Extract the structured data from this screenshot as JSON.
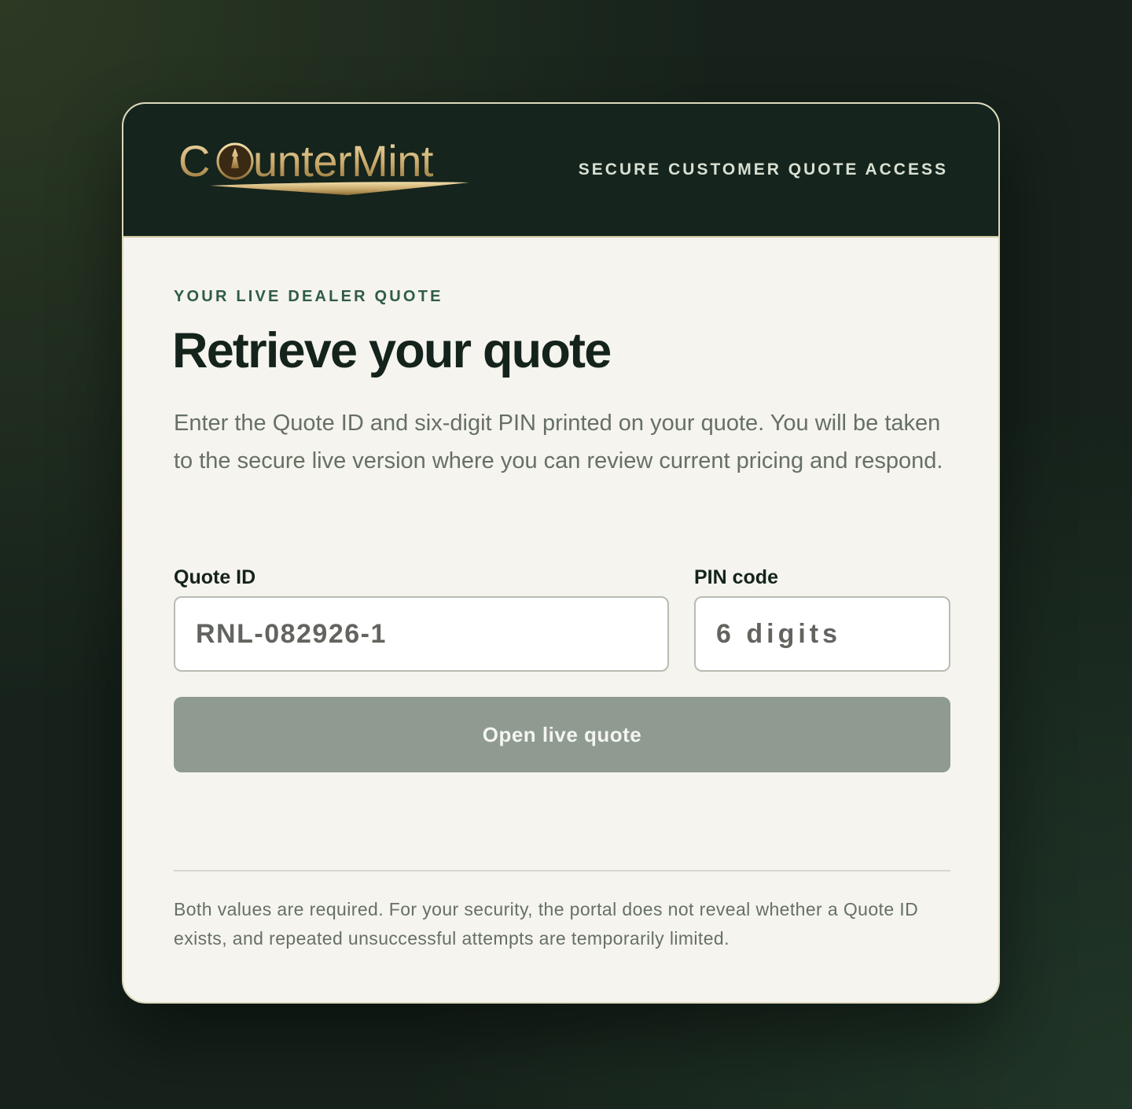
{
  "header": {
    "brand": "CounterMint",
    "tagline": "SECURE CUSTOMER QUOTE ACCESS"
  },
  "main": {
    "eyebrow": "YOUR LIVE DEALER QUOTE",
    "title": "Retrieve your quote",
    "description": "Enter the Quote ID and six-digit PIN printed on your quote. You will be taken to the secure live version where you can review current pricing and respond."
  },
  "form": {
    "quote_id_label": "Quote ID",
    "quote_id_placeholder": "RNL-082926-1",
    "pin_label": "PIN code",
    "pin_placeholder": "6 digits",
    "submit_label": "Open live quote"
  },
  "footer": {
    "note": "Both values are required. For your security, the portal does not reveal whether a Quote ID exists, and repeated unsuccessful attempts are temporarily limited."
  },
  "colors": {
    "header_bg": "#15241c",
    "card_bg": "#f5f4ee",
    "eyebrow": "#2f5c43",
    "button_disabled": "#8f9a90",
    "gold": "#c9a96a"
  }
}
